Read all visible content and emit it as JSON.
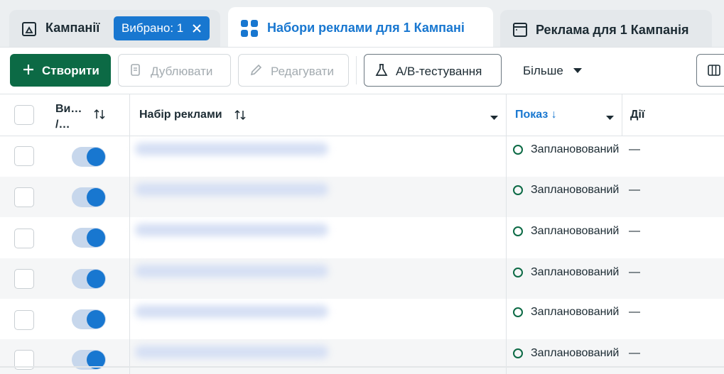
{
  "tabs": {
    "campaigns": {
      "label": "Кампанії",
      "selected_badge": "Вибрано: 1",
      "icon": "flag-icon"
    },
    "adsets": {
      "label": "Набори реклами для 1 Кампані",
      "icon": "grid-icon",
      "active": true
    },
    "ads": {
      "label": "Реклама для 1 Кампанія",
      "icon": "ad-window-icon"
    }
  },
  "toolbar": {
    "create_label": "Створити",
    "duplicate_label": "Дублювати",
    "edit_label": "Редагувати",
    "ab_label": "A/B-тестування",
    "more_label": "Більше"
  },
  "table": {
    "columns": {
      "toggle": {
        "line1": "Ви…",
        "line2": "/…"
      },
      "name": "Набір реклами",
      "delivery": "Показ ↓",
      "actions": "Дії"
    },
    "rows": [
      {
        "status": "Заплановований",
        "actions": "—",
        "on": true
      },
      {
        "status": "Заплановований",
        "actions": "—",
        "on": true
      },
      {
        "status": "Заплановований",
        "actions": "—",
        "on": true
      },
      {
        "status": "Заплановований",
        "actions": "—",
        "on": true
      },
      {
        "status": "Заплановований",
        "actions": "—",
        "on": true
      },
      {
        "status": "Заплановований",
        "actions": "—",
        "on": true
      }
    ]
  },
  "colors": {
    "primary": "#1877d0",
    "create": "#0c6a45",
    "status_ok": "#0c6a45"
  }
}
